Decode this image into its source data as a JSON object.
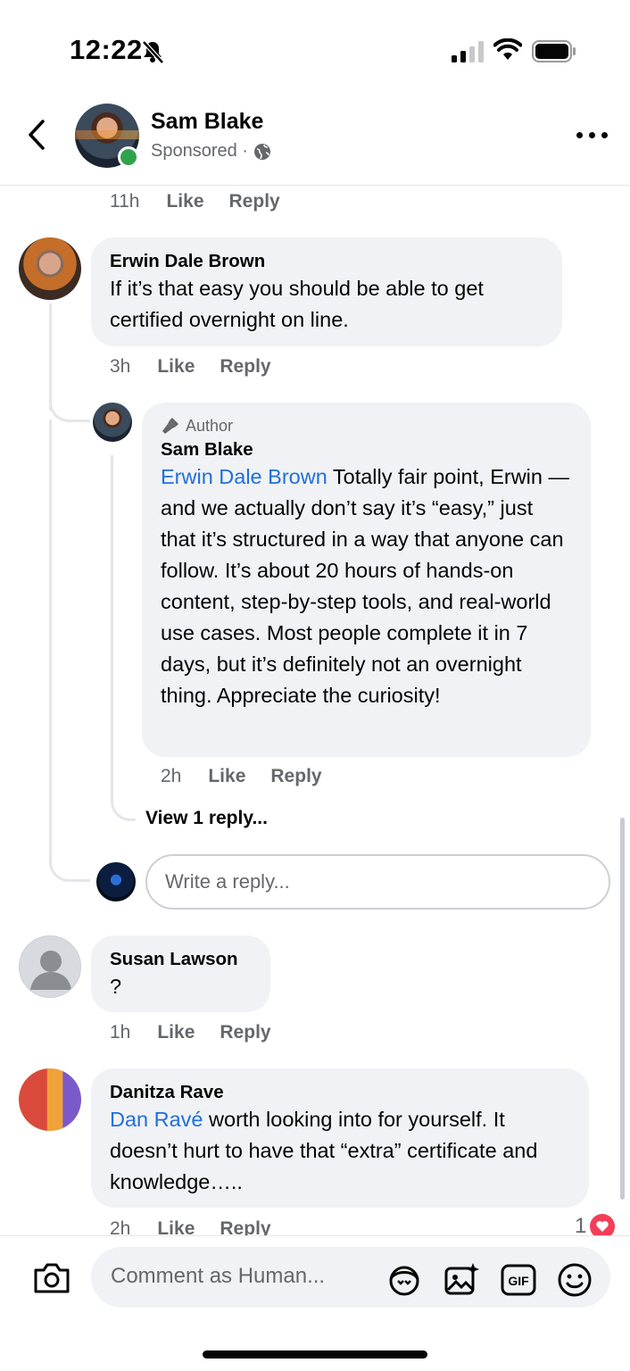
{
  "status_bar": {
    "time": "12:22"
  },
  "header": {
    "name": "Sam Blake",
    "subtitle": "Sponsored ·"
  },
  "comments": [
    {
      "time": "11h",
      "like": "Like",
      "reply": "Reply"
    },
    {
      "author": "Erwin Dale Brown",
      "text": "If it’s that easy you should be able to get certified overnight on line.",
      "time": "3h",
      "like": "Like",
      "reply": "Reply"
    },
    {
      "badge": "Author",
      "author": "Sam Blake",
      "mention": "Erwin Dale Brown",
      "text": "Totally fair point, Erwin — and we actually don’t say it’s “easy,” just that it’s structured in a way that anyone can follow. It’s about 20 hours of hands-on content, step-by-step tools, and real-world use cases. Most people complete it in 7 days, but it’s definitely not an overnight thing. Appreciate the curiosity!",
      "time": "2h",
      "like": "Like",
      "reply": "Reply"
    },
    {
      "author": "Susan Lawson",
      "text": "?",
      "time": "1h",
      "like": "Like",
      "reply": "Reply"
    },
    {
      "author": "Danitza Rave",
      "mention": "Dan Ravé",
      "text": "worth looking into for yourself.  It doesn’t hurt to have that “extra” certificate and knowledge…..",
      "time": "2h",
      "like": "Like",
      "reply": "Reply",
      "reaction_count": "1"
    }
  ],
  "view_replies": "View 1 reply...",
  "reply_input": {
    "placeholder": "Write a reply..."
  },
  "composer": {
    "placeholder": "Comment as Human...",
    "gif_label": "GIF"
  },
  "colors": {
    "mention": "#216fdb",
    "online": "#31a24c",
    "reaction": "#f33e58"
  }
}
